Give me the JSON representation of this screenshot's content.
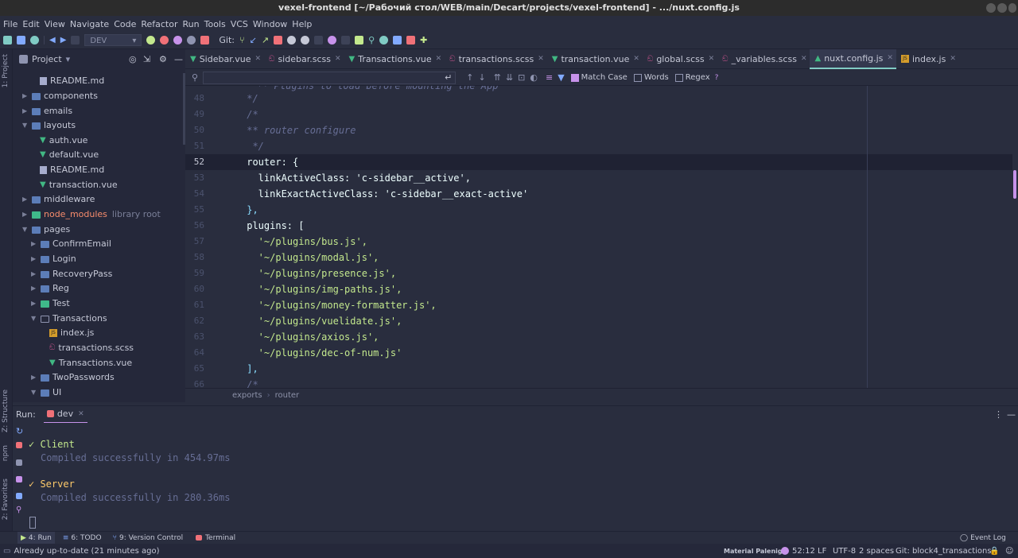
{
  "window": {
    "title": "vexel-frontend [~/Рабочий стол/WEB/main/Decart/projects/vexel-frontend] - .../nuxt.config.js"
  },
  "menu": [
    "File",
    "Edit",
    "View",
    "Navigate",
    "Code",
    "Refactor",
    "Run",
    "Tools",
    "VCS",
    "Window",
    "Help"
  ],
  "toolbar": {
    "run_config": "DEV",
    "git_label": "Git:"
  },
  "sidebar_strip": {
    "project": "1: Project",
    "structure": "Z: Structure",
    "npm": "npm",
    "favorites": "2: Favorites"
  },
  "project": {
    "title": "Project",
    "items": [
      {
        "label": "README.md"
      },
      {
        "label": "components"
      },
      {
        "label": "emails"
      },
      {
        "label": "layouts"
      },
      {
        "label": "auth.vue"
      },
      {
        "label": "default.vue"
      },
      {
        "label": "README.md"
      },
      {
        "label": "transaction.vue"
      },
      {
        "label": "middleware"
      },
      {
        "label": "node_modules",
        "suffix": "library root"
      },
      {
        "label": "pages"
      },
      {
        "label": "ConfirmEmail"
      },
      {
        "label": "Login"
      },
      {
        "label": "RecoveryPass"
      },
      {
        "label": "Reg"
      },
      {
        "label": "Test"
      },
      {
        "label": "Transactions"
      },
      {
        "label": "index.js"
      },
      {
        "label": "transactions.scss"
      },
      {
        "label": "Transactions.vue"
      },
      {
        "label": "TwoPasswords"
      },
      {
        "label": "UI"
      }
    ]
  },
  "tabs": [
    {
      "label": "Sidebar.vue"
    },
    {
      "label": "sidebar.scss"
    },
    {
      "label": "Transactions.vue"
    },
    {
      "label": "transactions.scss"
    },
    {
      "label": "transaction.vue"
    },
    {
      "label": "global.scss"
    },
    {
      "label": "_variables.scss"
    },
    {
      "label": "nuxt.config.js"
    },
    {
      "label": "index.js"
    }
  ],
  "find": {
    "match_case": "Match Case",
    "words": "Words",
    "regex": "Regex",
    "help": "?"
  },
  "code": {
    "lines": [
      {
        "n": "48",
        "t": " */"
      },
      {
        "n": "49",
        "t": " /*"
      },
      {
        "n": "50",
        "t": " ** router configure"
      },
      {
        "n": "51",
        "t": "  */"
      },
      {
        "n": "52",
        "t": " router: {"
      },
      {
        "n": "53",
        "t": "   linkActiveClass: 'c-sidebar__active',"
      },
      {
        "n": "54",
        "t": "   linkExactActiveClass: 'c-sidebar__exact-active'"
      },
      {
        "n": "55",
        "t": " },"
      },
      {
        "n": "56",
        "t": " plugins: ["
      },
      {
        "n": "57",
        "t": "   '~/plugins/bus.js',"
      },
      {
        "n": "58",
        "t": "   '~/plugins/modal.js',"
      },
      {
        "n": "59",
        "t": "   '~/plugins/presence.js',"
      },
      {
        "n": "60",
        "t": "   '~/plugins/img-paths.js',"
      },
      {
        "n": "61",
        "t": "   '~/plugins/money-formatter.js',"
      },
      {
        "n": "62",
        "t": "   '~/plugins/vuelidate.js',"
      },
      {
        "n": "63",
        "t": "   '~/plugins/axios.js',"
      },
      {
        "n": "64",
        "t": "   '~/plugins/dec-of-num.js'"
      },
      {
        "n": "65",
        "t": " ],"
      },
      {
        "n": "66",
        "t": " /*"
      }
    ]
  },
  "breadcrumbs": {
    "a": "exports",
    "b": "router"
  },
  "run": {
    "label": "Run:",
    "tab": "dev",
    "client_title": "Client",
    "client_msg": "Compiled successfully in 454.97ms",
    "server_title": "Server",
    "server_msg": "Compiled successfully in 280.36ms"
  },
  "bottom_tools": {
    "run": "4: Run",
    "todo": "6: TODO",
    "vcs": "9: Version Control",
    "terminal": "Terminal",
    "event_log": "Event Log"
  },
  "status": {
    "message": "Already up-to-date (21 minutes ago)",
    "theme": "Material Palenigh",
    "position": "52:12",
    "line_sep": "LF",
    "encoding": "UTF-8",
    "indent": "2 spaces",
    "git": "Git: block4_transactions"
  },
  "colors": {
    "accent": "#c792ea",
    "bg": "#292d3e",
    "string": "#c3e88d",
    "comment": "#676e95"
  }
}
